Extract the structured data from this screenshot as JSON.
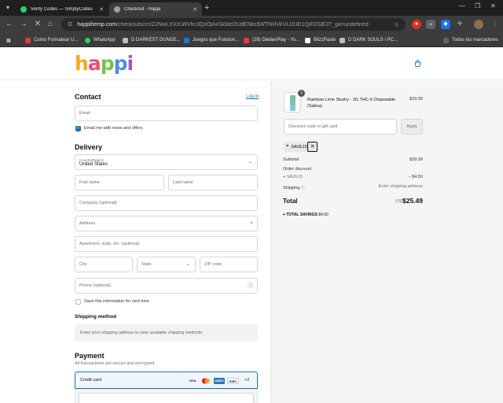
{
  "browser": {
    "tabs": [
      {
        "title": "Verify Codes — SimplyCodes",
        "active": false
      },
      {
        "title": "Checkout - Happi",
        "active": true
      }
    ],
    "url_host": "happihemp.com",
    "url_path": "/checkouts/cn/Z2NwLXVzLWVhc3QxOjAxSkMzOUdENks5WTNHVkVLOUE1QjFDSlE3?_ga=undefined",
    "bookmarks": [
      "Como Formatear U...",
      "WhatsApp",
      "D DARKEST DUNGE...",
      "Juegos que Funcion...",
      "(28) DeidenPlay - Yo...",
      "BlizzPaste",
      "D DARK SOULS I PC..."
    ],
    "all_bookmarks": "Todos los marcadores",
    "ext_badge": "11"
  },
  "brand": {
    "logo_letters": [
      "h",
      "a",
      "p",
      "p",
      "i"
    ]
  },
  "contact": {
    "heading": "Contact",
    "login": "Log in",
    "email_placeholder": "Email",
    "email_news": "Email me with news and offers"
  },
  "delivery": {
    "heading": "Delivery",
    "country_label": "Country/Region",
    "country_value": "United States",
    "first_name": "First name",
    "last_name": "Last name",
    "company": "Company (optional)",
    "address": "Address",
    "apartment": "Apartment, suite, etc. (optional)",
    "city": "City",
    "state": "State",
    "zip": "ZIP code",
    "phone": "Phone (optional)",
    "save_info": "Save this information for next time"
  },
  "shipping": {
    "heading": "Shipping method",
    "notice": "Enter your shipping address to view available shipping methods."
  },
  "payment": {
    "heading": "Payment",
    "subtitle": "All transactions are secure and encrypted.",
    "method": "Credit card",
    "brands": [
      "VISA",
      "MC",
      "AMEX",
      "DISC"
    ],
    "more": "+2"
  },
  "summary": {
    "product_name": "Rainbow Lime Slushy - 3G THC-X Disposable (Sativa)",
    "product_qty": "1",
    "product_price": "$29.99",
    "discount_placeholder": "Discount code or gift card",
    "apply": "Apply",
    "code": "SAVE15",
    "subtotal_label": "Subtotal",
    "subtotal_value": "$29.99",
    "order_discount_label": "Order discount",
    "discount_code": "SAVE15",
    "discount_value": "− $4.50",
    "shipping_label": "Shipping",
    "shipping_value": "Enter shipping address",
    "total_label": "Total",
    "currency": "USD",
    "total_value": "$25.49",
    "savings_label": "TOTAL SAVINGS",
    "savings_value": "$4.50"
  }
}
